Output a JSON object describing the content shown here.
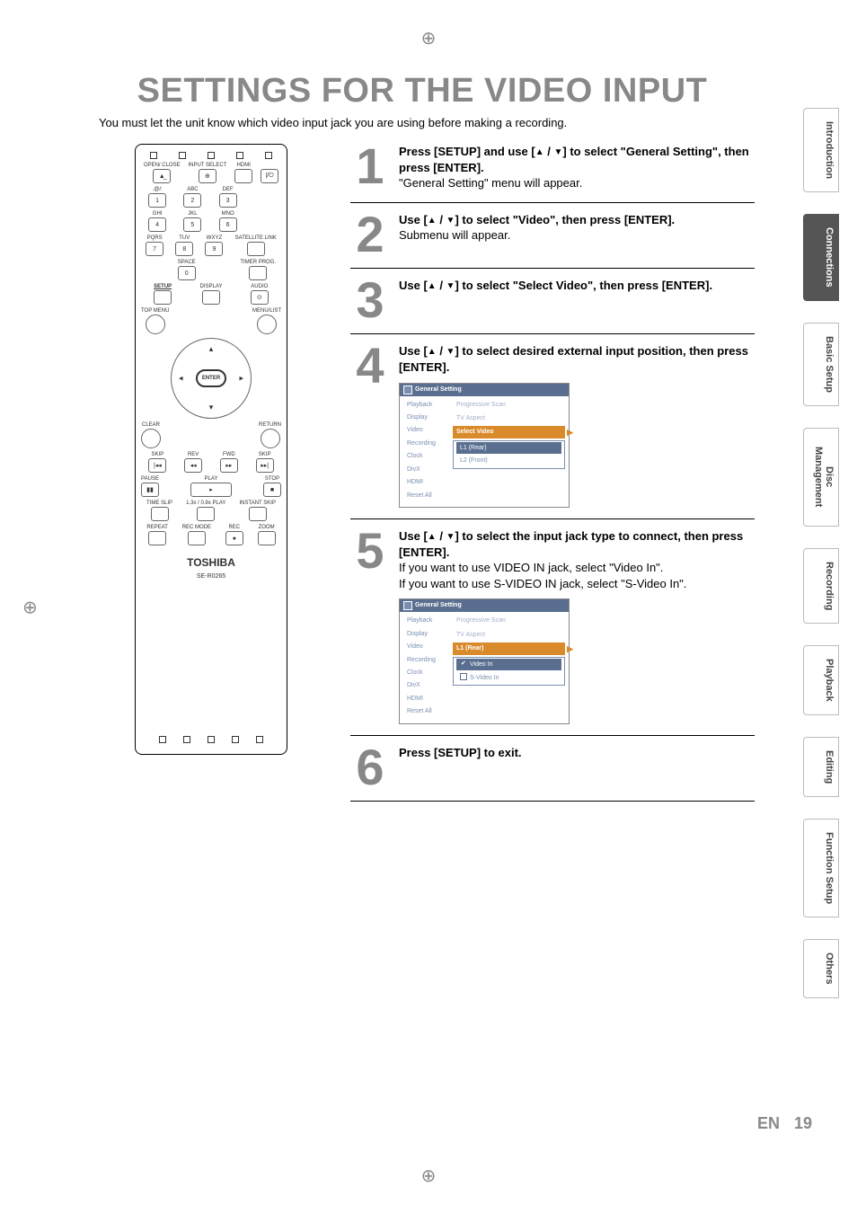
{
  "title": "SETTINGS FOR THE VIDEO INPUT",
  "intro": "You must let the unit know which video input jack you are using before making a recording.",
  "remote": {
    "topDots": 5,
    "row1": {
      "labels": [
        "OPEN/\nCLOSE",
        "INPUT\nSELECT",
        "HDMI"
      ],
      "extra": ""
    },
    "row2": {
      "labels": [
        "",
        "⊕",
        ""
      ],
      "powerLabel": "|/⏻"
    },
    "numRow1": {
      "over": [
        ".@/:",
        "ABC",
        "DEF"
      ],
      "keys": [
        "1",
        "2",
        "3"
      ]
    },
    "numRow2": {
      "over": [
        "GHI",
        "JKL",
        "MNO"
      ],
      "keys": [
        "4",
        "5",
        "6"
      ]
    },
    "numRow3": {
      "over": [
        "PQRS",
        "TUV",
        "WXYZ"
      ],
      "keys": [
        "7",
        "8",
        "9"
      ],
      "side": "SATELLITE\nLINK"
    },
    "numRow4": {
      "over": [
        "",
        "SPACE",
        ""
      ],
      "keys": [
        "",
        "0",
        ""
      ],
      "side": "TIMER\nPROG."
    },
    "setupRow": {
      "labels": [
        "SETUP",
        "DISPLAY",
        "AUDIO"
      ],
      "audioIcon": "⊙"
    },
    "menuRow": {
      "left": "TOP MENU",
      "right": "MENU/LIST"
    },
    "wheel": {
      "enter": "ENTER",
      "left": "◂",
      "right": "▸",
      "up": "▴",
      "down": "▾"
    },
    "clearRow": {
      "left": "CLEAR",
      "right": "RETURN"
    },
    "row_skip": {
      "labels": [
        "SKIP",
        "REV",
        "FWD",
        "SKIP"
      ],
      "icons": [
        "|◂◂",
        "◂◂",
        "▸▸",
        "▸▸|"
      ]
    },
    "row_play": {
      "labels": [
        "PAUSE",
        "PLAY",
        "STOP"
      ],
      "icons": [
        "▮▮",
        "▸",
        "■"
      ]
    },
    "row_extra": {
      "labels": [
        "TIME SLIP",
        "1.3x / 0.8x PLAY",
        "INSTANT SKIP"
      ]
    },
    "row_bottom": {
      "labels": [
        "REPEAT",
        "REC MODE",
        "REC",
        "ZOOM"
      ],
      "recDot": "●"
    },
    "brand": "TOSHIBA",
    "model": "SE-R0265",
    "bottomDots": 5
  },
  "steps": [
    {
      "num": "1",
      "hd_parts": [
        "Press [SETUP] and use [",
        " / ",
        "] to select \"General Setting\", then press [ENTER]."
      ],
      "sub": "\"General Setting\" menu will appear."
    },
    {
      "num": "2",
      "hd_parts": [
        "Use [",
        " / ",
        "] to select \"Video\", then press [ENTER]."
      ],
      "sub": "Submenu will appear."
    },
    {
      "num": "3",
      "hd_parts": [
        "Use [",
        " / ",
        "] to select \"Select Video\", then press [ENTER]."
      ],
      "sub": ""
    },
    {
      "num": "4",
      "hd_parts": [
        "Use [",
        " / ",
        "] to select desired external input position, then press [ENTER]."
      ],
      "sub": "",
      "osd": {
        "title": "General Setting",
        "left": [
          "Playback",
          "Display",
          "Video",
          "Recording",
          "Clock",
          "DivX",
          "HDMI",
          "Reset All"
        ],
        "rightTop": [
          "Progressive Scan",
          "TV Aspect"
        ],
        "highlight": "Select Video",
        "rightList": [
          "L1 (Rear)",
          "L2 (Front)"
        ],
        "rightListHL": 0
      }
    },
    {
      "num": "5",
      "hd_parts": [
        "Use [",
        " / ",
        "] to select the input jack type to connect, then press [ENTER]."
      ],
      "sub": "If you want to use VIDEO IN jack, select \"Video In\".\n If you want to use S-VIDEO IN jack, select \"S-Video In\".",
      "osd": {
        "title": "General Setting",
        "left": [
          "Playback",
          "Display",
          "Video",
          "Recording",
          "Clock",
          "DivX",
          "HDMI",
          "Reset All"
        ],
        "rightTop": [
          "Progressive Scan",
          "TV Aspect"
        ],
        "highlight": "L1 (Rear)",
        "rightList": [
          "Video In",
          "S-Video In"
        ],
        "checks": [
          true,
          false
        ],
        "rightListHL": 0
      }
    },
    {
      "num": "6",
      "hd_plain": "Press [SETUP] to exit.",
      "sub": ""
    }
  ],
  "tabs": [
    "Introduction",
    "Connections",
    "Basic Setup",
    "Disc\nManagement",
    "Recording",
    "Playback",
    "Editing",
    "Function Setup",
    "Others"
  ],
  "activeTab": 1,
  "footer": {
    "lang": "EN",
    "page": "19"
  }
}
